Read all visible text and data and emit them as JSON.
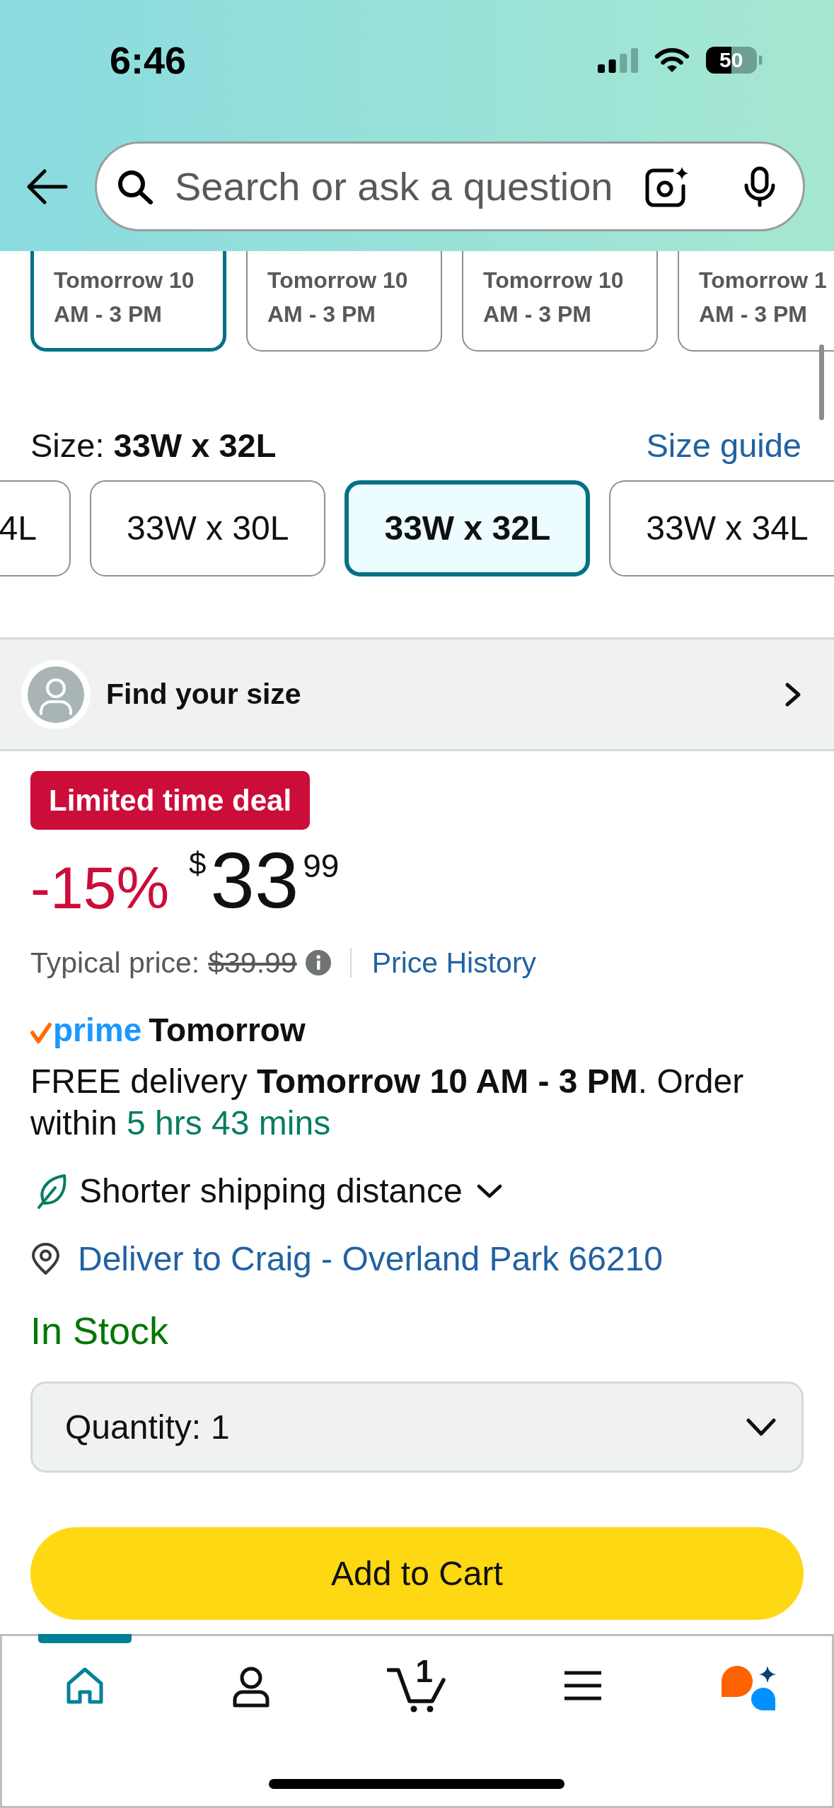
{
  "status_bar": {
    "time": "6:46",
    "battery": "50"
  },
  "search": {
    "placeholder": "Search or ask a question"
  },
  "delivery_slots": [
    {
      "lines": [
        "Tomorrow 10",
        "AM - 3 PM"
      ],
      "selected": true
    },
    {
      "lines": [
        "Tomorrow 10",
        "AM - 3 PM"
      ],
      "selected": false
    },
    {
      "lines": [
        "Tomorrow 10",
        "AM - 3 PM"
      ],
      "selected": false
    },
    {
      "lines": [
        "Tomorrow 1",
        "AM - 3 PM"
      ],
      "selected": false
    }
  ],
  "size": {
    "label": "Size: **33W x 32L**",
    "guide_link": "Size guide",
    "options": [
      {
        "label": "4L",
        "selected": false
      },
      {
        "label": "33W x 30L",
        "selected": false
      },
      {
        "label": "33W x 32L",
        "selected": true
      },
      {
        "label": "33W x 34L",
        "selected": false
      }
    ]
  },
  "find_your_size": {
    "label": "Find your size"
  },
  "deal_badge": "Limited time deal",
  "price": {
    "discount": "-15%",
    "currency": "$",
    "whole": "33",
    "fraction": "99",
    "typical_label": "Typical price:",
    "typical_value": "$39.99",
    "history_link": "Price History"
  },
  "delivery": {
    "prime_logo": "prime",
    "speed": "Tomorrow",
    "message": "FREE delivery **Tomorrow 10 AM - 3 PM**. Order within",
    "countdown": "5 hrs 43 mins",
    "shipping_note": "Shorter shipping distance",
    "location_link": "Deliver to Craig - Overland Park 66210"
  },
  "availability": "In Stock",
  "quantity": {
    "label": "Quantity:",
    "value": "1"
  },
  "add_to_cart": "Add to Cart",
  "bottom_nav": [
    {
      "kind": "home",
      "selected": true
    },
    {
      "kind": "account",
      "selected": false
    },
    {
      "kind": "cart",
      "selected": false,
      "count": "1"
    },
    {
      "kind": "menu",
      "selected": false
    },
    {
      "kind": "assistant",
      "selected": false
    }
  ]
}
